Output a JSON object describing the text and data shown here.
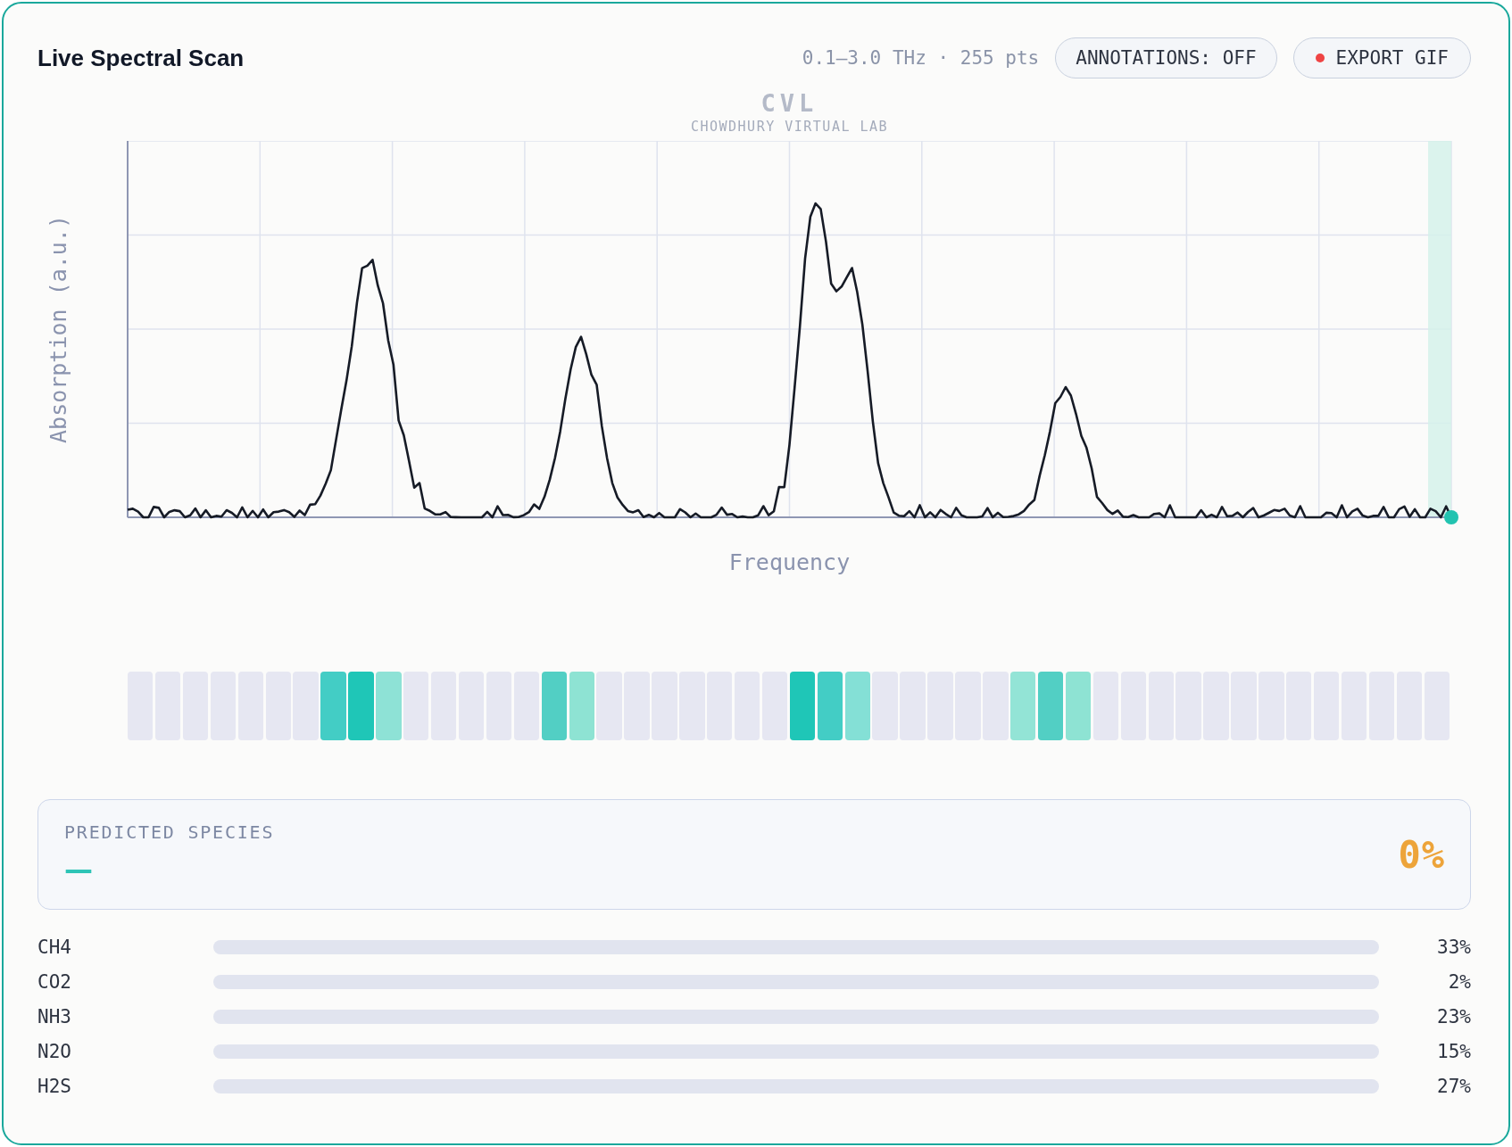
{
  "header": {
    "title": "Live Spectral Scan",
    "range_info": "0.1–3.0 THz · 255 pts",
    "buttons": [
      {
        "kind": "toggle",
        "label": "ANNOTATIONS: OFF"
      },
      {
        "kind": "record",
        "label": "EXPORT GIF"
      }
    ]
  },
  "plot": {
    "logo": "CVL",
    "logo_subtitle": "CHOWDHURY VIRTUAL LAB",
    "ylabel": "Absorption (a.u.)",
    "xlabel": "Frequency"
  },
  "band_strip": {
    "cells": [
      {
        "color": "#e6e7f2"
      },
      {
        "color": "#e6e7f2"
      },
      {
        "color": "#e6e7f2"
      },
      {
        "color": "#e6e7f2"
      },
      {
        "color": "#e6e7f2"
      },
      {
        "color": "#e6e7f2"
      },
      {
        "color": "#e6e7f2"
      },
      {
        "color": "#43cdc5"
      },
      {
        "color": "#1fc6b7"
      },
      {
        "color": "#8ee2d6"
      },
      {
        "color": "#e6e7f2"
      },
      {
        "color": "#e6e7f2"
      },
      {
        "color": "#e6e7f2"
      },
      {
        "color": "#e6e7f2"
      },
      {
        "color": "#e6e7f2"
      },
      {
        "color": "#52cfc4"
      },
      {
        "color": "#8ee3d3"
      },
      {
        "color": "#e6e7f2"
      },
      {
        "color": "#e6e7f2"
      },
      {
        "color": "#e6e7f2"
      },
      {
        "color": "#e6e7f2"
      },
      {
        "color": "#e6e7f2"
      },
      {
        "color": "#e6e7f2"
      },
      {
        "color": "#e6e7f2"
      },
      {
        "color": "#1fc6b7"
      },
      {
        "color": "#43cdc5"
      },
      {
        "color": "#84e0d6"
      },
      {
        "color": "#e6e7f2"
      },
      {
        "color": "#e6e7f2"
      },
      {
        "color": "#e6e7f2"
      },
      {
        "color": "#e6e7f2"
      },
      {
        "color": "#e6e7f2"
      },
      {
        "color": "#93e4d6"
      },
      {
        "color": "#52cfc4"
      },
      {
        "color": "#8ee3d3"
      },
      {
        "color": "#e6e7f2"
      },
      {
        "color": "#e6e7f2"
      },
      {
        "color": "#e6e7f2"
      },
      {
        "color": "#e6e7f2"
      },
      {
        "color": "#e6e7f2"
      },
      {
        "color": "#e6e7f2"
      },
      {
        "color": "#e6e7f2"
      },
      {
        "color": "#e6e7f2"
      },
      {
        "color": "#e6e7f2"
      },
      {
        "color": "#e6e7f2"
      },
      {
        "color": "#e6e7f2"
      },
      {
        "color": "#e6e7f2"
      },
      {
        "color": "#e6e7f2"
      }
    ]
  },
  "prediction": {
    "heading": "PREDICTED SPECIES",
    "species": "—",
    "confidence": "0%"
  },
  "species_scores": [
    {
      "name": "CH4",
      "reading": "33%"
    },
    {
      "name": "CO2",
      "reading": "2%"
    },
    {
      "name": "NH3",
      "reading": "23%"
    },
    {
      "name": "N2O",
      "reading": "15%"
    },
    {
      "name": "H2S",
      "reading": "27%"
    }
  ]
}
